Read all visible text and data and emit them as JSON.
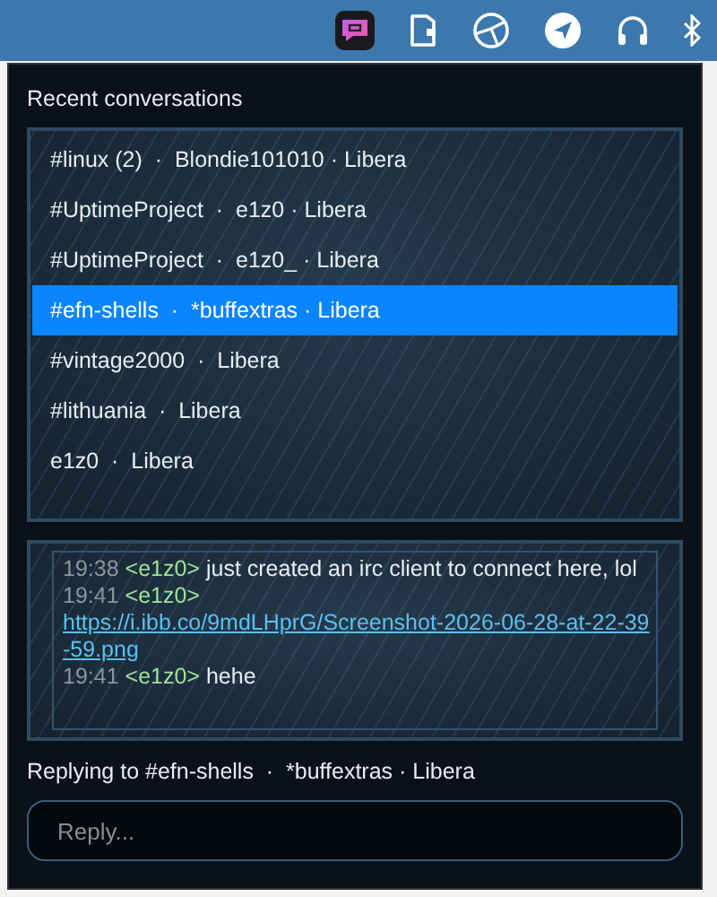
{
  "panel": {
    "title": "Recent conversations"
  },
  "conversations": [
    {
      "label": "#linux (2)  ·  Blondie101010 · Libera",
      "selected": false
    },
    {
      "label": "#UptimeProject  ·  e1z0 · Libera",
      "selected": false
    },
    {
      "label": "#UptimeProject  ·  e1z0_ · Libera",
      "selected": false
    },
    {
      "label": "#efn-shells  ·  *buffextras · Libera",
      "selected": true
    },
    {
      "label": "#vintage2000  ·  Libera",
      "selected": false
    },
    {
      "label": "#lithuania  ·  Libera",
      "selected": false
    },
    {
      "label": "e1z0  ·  Libera",
      "selected": false
    }
  ],
  "messages": [
    {
      "time": "19:38",
      "nick": "<e1z0>",
      "kind": "text",
      "text": "just created an irc client to connect here, lol"
    },
    {
      "time": "19:41",
      "nick": "<e1z0>",
      "kind": "link",
      "text": "https://i.ibb.co/9mdLHprG/Screenshot-2026-06-28-at-22-39-59.png"
    },
    {
      "time": "19:41",
      "nick": "<e1z0>",
      "kind": "text",
      "text": "hehe"
    }
  ],
  "replying_to": "Replying to #efn-shells  ·  *buffextras · Libera",
  "reply": {
    "placeholder": "Reply..."
  }
}
